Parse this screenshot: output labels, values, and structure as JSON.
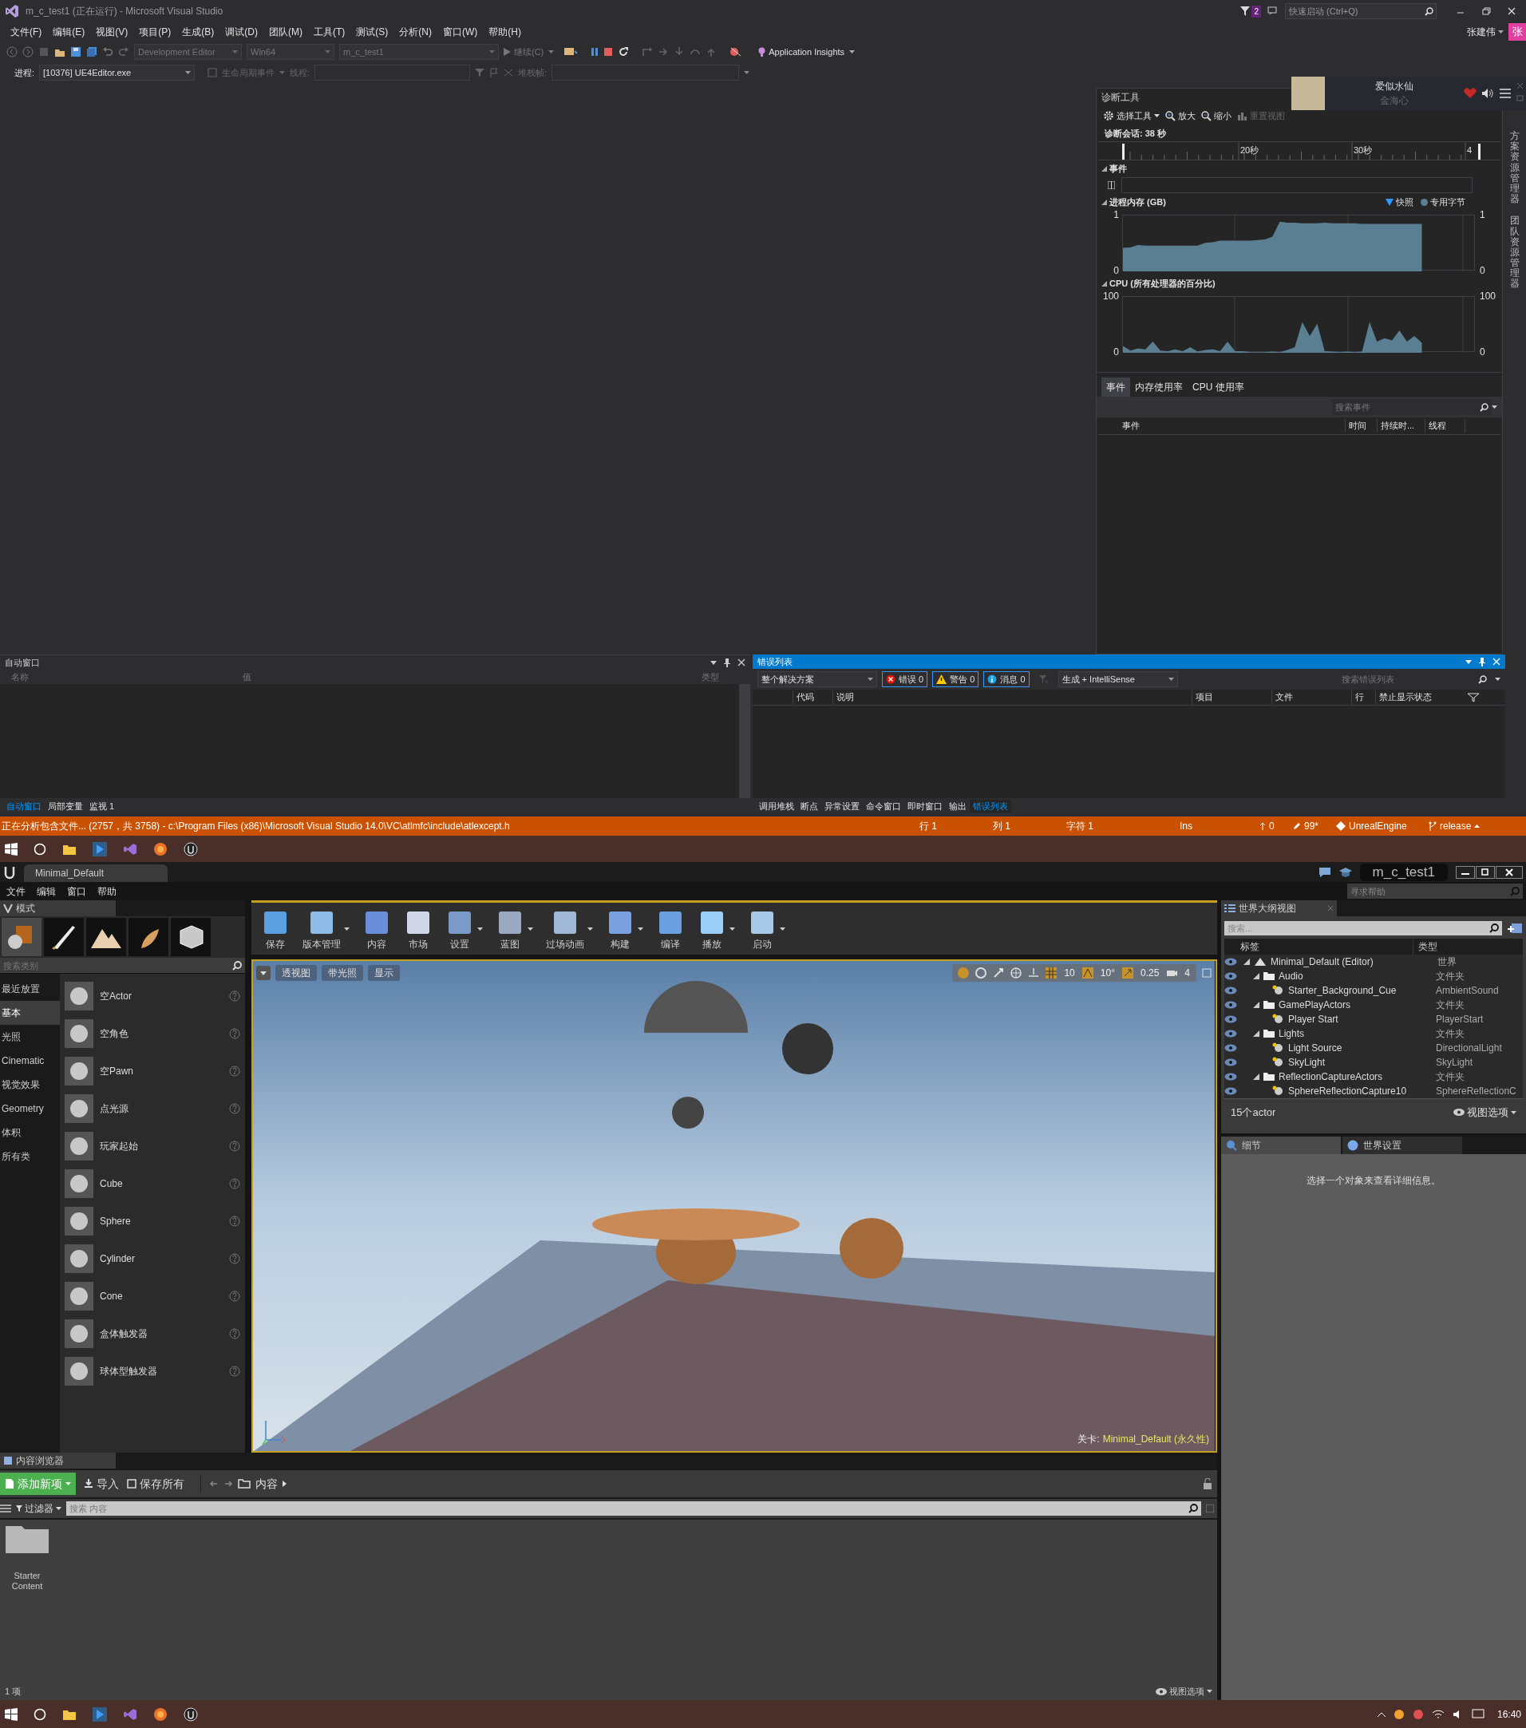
{
  "vs": {
    "title": "m_c_test1 (正在运行) - Microsoft Visual Studio",
    "notification_count": "2",
    "quick_launch": {
      "placeholder": "快速启动 (Ctrl+Q)"
    },
    "menu": [
      "文件(F)",
      "编辑(E)",
      "视图(V)",
      "项目(P)",
      "生成(B)",
      "调试(D)",
      "团队(M)",
      "工具(T)",
      "测试(S)",
      "分析(N)",
      "窗口(W)",
      "帮助(H)"
    ],
    "user": "张建伟",
    "avatar_initial": "张",
    "toolbar": {
      "config": "Development Editor",
      "platform": "Win64",
      "project": "m_c_test1",
      "continue": "继续(C)",
      "insights": "Application Insights"
    },
    "debug_bar": {
      "process_label": "进程:",
      "process": "[10376] UE4Editor.exe",
      "lifecycle": "生命周期事件",
      "thread_label": "线程:",
      "stack_label": "堆栈帧:"
    },
    "music_player": {
      "song": "爱似水仙",
      "artist": "金海心"
    },
    "diagnostics": {
      "title": "诊断工具",
      "tools": [
        {
          "label": "选择工具",
          "disabled": false
        },
        {
          "label": "放大",
          "disabled": false
        },
        {
          "label": "缩小",
          "disabled": false
        },
        {
          "label": "重置视图",
          "disabled": true
        }
      ],
      "session": "诊断会话: 38 秒",
      "ruler_ticks": [
        "20秒",
        "30秒",
        "4"
      ],
      "events_title": "事件",
      "memory": {
        "title": "进程内存 (GB)",
        "legend_snapshot": "快照",
        "right_ticks": [
          "1",
          "0"
        ],
        "chart_data": {
          "type": "area",
          "ylim": [
            0,
            1
          ],
          "yticks": [
            0,
            1
          ],
          "series": [
            {
              "name": "专用字节",
              "color": "#5a7f93",
              "values": [
                0.42,
                0.43,
                0.47,
                0.46,
                0.46,
                0.46,
                0.46,
                0.46,
                0.46,
                0.46,
                0.46,
                0.51,
                0.52,
                0.55,
                0.55,
                0.55,
                0.55,
                0.55,
                0.56,
                0.57,
                0.62,
                0.89,
                0.87,
                0.87,
                0.86,
                0.86,
                0.86,
                0.87,
                0.86,
                0.86,
                0.86,
                0.86,
                0.85,
                0.85,
                0.85,
                0.85,
                0.85,
                0.85,
                0.85,
                0.85,
                0.85,
                null,
                null,
                null
              ]
            }
          ]
        }
      },
      "cpu": {
        "title": "CPU (所有处理器的百分比)",
        "right_ticks": [
          "100",
          "0"
        ],
        "chart_data": {
          "type": "area",
          "ylim": [
            0,
            100
          ],
          "yticks": [
            0,
            100
          ],
          "series": [
            {
              "color": "#5a7f93",
              "values": [
                12,
                4,
                8,
                6,
                20,
                4,
                3,
                6,
                3,
                10,
                2,
                5,
                6,
                3,
                20,
                3,
                3,
                1,
                1,
                1,
                2,
                1,
                5,
                10,
                55,
                30,
                52,
                3,
                2,
                1,
                2,
                1,
                2,
                55,
                20,
                26,
                22,
                40,
                20,
                30,
                18,
                null,
                null,
                null
              ]
            }
          ]
        }
      },
      "tabs": [
        {
          "label": "事件",
          "selected": true
        },
        {
          "label": "内存使用率",
          "selected": false
        },
        {
          "label": "CPU 使用率",
          "selected": false
        }
      ],
      "search": {
        "placeholder": "搜索事件"
      },
      "columns": [
        "事件",
        "时间",
        "持续时...",
        "线程"
      ]
    },
    "side_tabs": [
      "方案资源管理器",
      "团队资源管理器"
    ],
    "autos": {
      "title": "自动窗口",
      "columns": [
        "名称",
        "值",
        "类型"
      ],
      "tabs": [
        {
          "label": "自动窗口",
          "selected": true
        },
        {
          "label": "局部变量",
          "selected": false
        },
        {
          "label": "监视 1",
          "selected": false
        }
      ]
    },
    "error_list": {
      "title": "错误列表",
      "scope": "整个解决方案",
      "filters": [
        {
          "kind": "error",
          "label": "错误 0"
        },
        {
          "kind": "warning",
          "label": "警告 0"
        },
        {
          "kind": "info",
          "label": "消息 0"
        }
      ],
      "source": "生成 + IntelliSense",
      "search": {
        "placeholder": "搜索错误列表"
      },
      "columns": [
        "代码",
        "说明",
        "项目",
        "文件",
        "行",
        "禁止显示状态"
      ],
      "tabs": [
        {
          "label": "调用堆栈",
          "selected": false
        },
        {
          "label": "断点",
          "selected": false
        },
        {
          "label": "异常设置",
          "selected": false
        },
        {
          "label": "命令窗口",
          "selected": false
        },
        {
          "label": "即时窗口",
          "selected": false
        },
        {
          "label": "输出",
          "selected": false
        },
        {
          "label": "错误列表",
          "selected": true
        }
      ]
    },
    "status_bar": {
      "message": "正在分析包含文件... (2757，共 3758) - c:\\Program Files (x86)\\Microsoft Visual Studio 14.0\\VC\\atlmfc\\include\\atlexcept.h",
      "line": "行 1",
      "column": "列 1",
      "char": "字符 1",
      "mode": "Ins",
      "pushes": "0",
      "edits": "99*",
      "repo": "UnrealEngine",
      "branch": "release"
    }
  },
  "ue": {
    "level_tab": "Minimal_Default",
    "project": "m_c_test1",
    "help_search": {
      "placeholder": "寻求帮助"
    },
    "menu": [
      "文件",
      "编辑",
      "窗口",
      "帮助"
    ],
    "modes": {
      "tab": "模式",
      "search": {
        "placeholder": "搜索类别"
      },
      "categories": [
        {
          "label": "最近放置",
          "selected": false
        },
        {
          "label": "基本",
          "selected": true
        },
        {
          "label": "光照",
          "selected": false
        },
        {
          "label": "Cinematic",
          "selected": false
        },
        {
          "label": "视觉效果",
          "selected": false
        },
        {
          "label": "Geometry",
          "selected": false
        },
        {
          "label": "体积",
          "selected": false
        },
        {
          "label": "所有类",
          "selected": false
        }
      ],
      "items": [
        "空Actor",
        "空角色",
        "空Pawn",
        "点光源",
        "玩家起始",
        "Cube",
        "Sphere",
        "Cylinder",
        "Cone",
        "盒体触发器",
        "球体型触发器"
      ]
    },
    "toolbar": [
      {
        "label": "保存",
        "dropdown": false
      },
      {
        "label": "版本管理",
        "dropdown": true
      },
      {
        "label": "内容",
        "dropdown": false
      },
      {
        "label": "市场",
        "dropdown": false
      },
      {
        "label": "设置",
        "dropdown": true
      },
      {
        "label": "蓝图",
        "dropdown": true
      },
      {
        "label": "过场动画",
        "dropdown": true
      },
      {
        "label": "构建",
        "dropdown": true
      },
      {
        "label": "编译",
        "dropdown": false
      },
      {
        "label": "播放",
        "dropdown": true
      },
      {
        "label": "启动",
        "dropdown": true
      }
    ],
    "viewport": {
      "buttons": [
        "透视图",
        "带光照",
        "显示"
      ],
      "snaps": [
        "10",
        "10°",
        "0.25",
        "4"
      ],
      "level_label": "关卡:",
      "level": "Minimal_Default (永久性)"
    },
    "outliner": {
      "tab": "世界大纲视图",
      "search": {
        "placeholder": "搜索..."
      },
      "columns": [
        "标签",
        "类型"
      ],
      "tree": [
        {
          "label": "Minimal_Default (Editor)",
          "type": "世界",
          "kind": "world",
          "expanded": true,
          "children": [
            {
              "label": "Audio",
              "type": "文件夹",
              "kind": "folder",
              "expanded": true,
              "children": [
                {
                  "label": "Starter_Background_Cue",
                  "type": "AmbientSound",
                  "kind": "actor"
                }
              ]
            },
            {
              "label": "GamePlayActors",
              "type": "文件夹",
              "kind": "folder",
              "expanded": true,
              "children": [
                {
                  "label": "Player Start",
                  "type": "PlayerStart",
                  "kind": "actor"
                }
              ]
            },
            {
              "label": "Lights",
              "type": "文件夹",
              "kind": "folder",
              "expanded": true,
              "children": [
                {
                  "label": "Light Source",
                  "type": "DirectionalLight",
                  "kind": "actor"
                },
                {
                  "label": "SkyLight",
                  "type": "SkyLight",
                  "kind": "actor"
                }
              ]
            },
            {
              "label": "ReflectionCaptureActors",
              "type": "文件夹",
              "kind": "folder",
              "expanded": true,
              "children": [
                {
                  "label": "SphereReflectionCapture10",
                  "type": "SphereReflectionC",
                  "kind": "actor"
                }
              ]
            }
          ]
        }
      ],
      "count": "15个actor",
      "view_options": "视图选项"
    },
    "details": {
      "tabs": [
        {
          "label": "细节",
          "selected": true
        },
        {
          "label": "世界设置",
          "selected": false
        }
      ],
      "message": "选择一个对象来查看详细信息。"
    },
    "content_browser": {
      "tab": "内容浏览器",
      "add_new": "添加新项",
      "import": "导入",
      "save_all": "保存所有",
      "path": "内容",
      "filters": "过滤器",
      "search": {
        "placeholder": "搜索 内容"
      },
      "folders": [
        "Starter Content"
      ],
      "item_count": "1 项",
      "view_options": "视图选项"
    }
  },
  "taskbar": {
    "time": "16:40"
  }
}
